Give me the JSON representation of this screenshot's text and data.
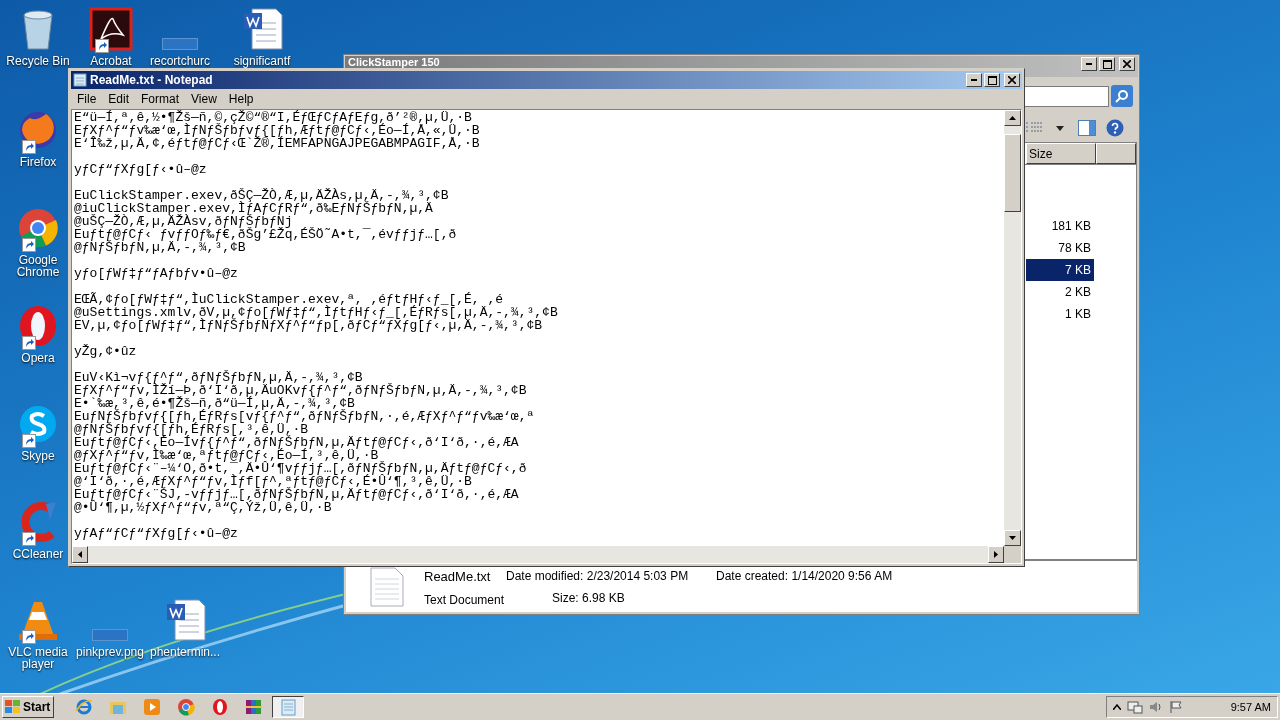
{
  "desktop_icons": [
    {
      "label": "Recycle Bin",
      "kind": "recycle",
      "shortcut": false
    },
    {
      "label": "Acrobat",
      "kind": "acrobat",
      "shortcut": true
    },
    {
      "label": "recortchurc",
      "kind": "image",
      "shortcut": false
    },
    {
      "label": "significantf",
      "kind": "word",
      "shortcut": false
    },
    {
      "label": "Firefox",
      "kind": "firefox",
      "shortcut": true
    },
    {
      "label": "Google Chrome",
      "kind": "chrome",
      "shortcut": true
    },
    {
      "label": "Opera",
      "kind": "opera",
      "shortcut": true
    },
    {
      "label": "Skype",
      "kind": "skype",
      "shortcut": true
    },
    {
      "label": "CCleaner",
      "kind": "ccleaner",
      "shortcut": true
    },
    {
      "label": "VLC media player",
      "kind": "vlc",
      "shortcut": true
    },
    {
      "label": "pinkprev.png",
      "kind": "image",
      "shortcut": false
    },
    {
      "label": "phentermin...",
      "kind": "word",
      "shortcut": false
    }
  ],
  "explorer": {
    "title": "ClickStamper 150",
    "column": "Size",
    "rows": [
      {
        "size": "181 KB",
        "selected": false
      },
      {
        "size": "78 KB",
        "selected": false
      },
      {
        "size": "7 KB",
        "selected": true
      },
      {
        "size": "2 KB",
        "selected": false
      },
      {
        "size": "1 KB",
        "selected": false
      }
    ],
    "details": {
      "name": "ReadMe.txt",
      "type": "Text Document",
      "modified_label": "Date modified:",
      "modified": "2/23/2014 5:03 PM",
      "created_label": "Date created:",
      "created": "1/14/2020 9:56 AM",
      "size_label": "Size:",
      "size": "6.98 KB"
    }
  },
  "notepad": {
    "title": "ReadMe.txt - Notepad",
    "menu": [
      "File",
      "Edit",
      "Format",
      "View",
      "Help"
    ],
    "paragraphs": [
      [
        "E“ü—Í,ª,ê,½•¶Žš—ñ,©,çŽ©“®“I,ÉƒŒƒCƒAƒEƒg,ð’²®,µ,Ü,·B",
        "EƒXƒ^ƒ“ƒv‰æ‘œ,ÌƒNƒŠƒbƒvƒ{[ƒh,Æƒtƒ@ƒCƒ‹,Éo—Í,Å,«,Ü,·B",
        "E‘Î‰ž,µ,Ä,¢,éƒtƒ@ƒCƒ‹Œ`Ž®,ÍEMFAPNGAJPEGABMPAGIF,Å,·B"
      ],
      [
        "yƒCƒ“ƒXƒg[ƒ‹•û–@z"
      ],
      [
        "EuClickStamper.exev,ðŠÇ—ŽÒ,Æ,µ,ÄŽÀs,µ,Ä,-,¾,³,¢B",
        "@iuClickStamper.exev,ÌƒAƒCƒRƒ“,ð‰EƒNƒŠƒbƒN,µ,Ä",
        "@uŠÇ—ŽÒ,Æ,µ,ÄŽÀsv,ðƒNƒŠƒbƒNj",
        "Euƒtƒ@ƒCƒ‹ ƒvƒƒOƒ‰ƒ€,ðŠg’£Žq,ÉŠÖ˜A•t,¯,évƒƒjƒ…[,ð",
        "@ƒNƒŠƒbƒN,µ,Ä,-,¾,³,¢B"
      ],
      [
        "yƒo[ƒWƒ‡ƒ“ƒAƒbƒv•û–@z"
      ],
      [
        "EŒÃ,¢ƒo[ƒWƒ‡ƒ“,ÌuClickStamper.exev,ª, ,éƒtƒHƒ‹ƒ_[,É, ,é",
        "@uSettings.xmlv,ðV,µ,¢ƒo[ƒWƒ‡ƒ“,ÌƒtƒHƒ‹ƒ_[,ÉƒRƒs[,µ,Ä,-,¾,³,¢B",
        "EV,µ,¢ƒo[ƒWƒ‡ƒ“,ÌƒNƒŠƒbƒNƒXƒ^ƒ“ƒp[,ðƒCƒ“ƒXƒg[ƒ‹,µ,Ä,-,¾,³,¢B"
      ],
      [
        "yŽg,¢•ûz"
      ],
      [
        "EuV‹Kì¬vƒ{ƒ^ƒ“,ðƒNƒŠƒbƒN,µ,Ä,-,¾,³,¢B",
        "EƒXƒ^ƒ“ƒv,ÌŽí—Þ,ð‘I‘ð,µ,ÄuOKvƒ{ƒ^ƒ“,ðƒNƒŠƒbƒN,µ,Ä,-,¾,³,¢B",
        "E•`‰æ,³,ê,é•¶Žš—ñ,ð“ü—Í,µ,Ä,-,¾,³,¢B",
        "EuƒNƒŠƒbƒvƒ{[ƒh,ÉƒRƒs[vƒ{ƒ^ƒ“,ðƒNƒŠƒbƒN,·,é,ÆƒXƒ^ƒ“ƒv‰æ‘œ,ª",
        "@ƒNƒŠƒbƒvƒ{[ƒh,ÉƒRƒs[,³,ê,Ü,·B",
        "Euƒtƒ@ƒCƒ‹,Éo—Ívƒ{ƒ^ƒ“,ðƒNƒŠƒbƒN,µ,Äƒtƒ@ƒCƒ‹,ð‘I‘ð,·,é,ÆA",
        "@ƒXƒ^ƒ“ƒv,Ì‰æ‘œ,ªƒtƒ@ƒCƒ‹,Éo—Í,³,ê,Ü,·B",
        "Euƒtƒ@ƒCƒ‹¨–¼‘O,ð•t,¯,Ä•Û‘¶vƒƒjƒ…[,ðƒNƒŠƒbƒN,µ,Äƒtƒ@ƒCƒ‹,ð",
        "@‘I‘ð,·,é,ÆƒXƒ^ƒ“ƒv,Ìƒf[ƒ^,ªƒtƒ@ƒCƒ‹,É•Û‘¶,³,ê,Ü,·B",
        "Euƒtƒ@ƒCƒ‹¨ŠJ,-vƒƒjƒ…[,ðƒNƒŠƒbƒN,µ,Äƒtƒ@ƒCƒ‹,ð‘I‘ð,·,é,ÆA",
        "@•Û‘¶,µ,½ƒXƒ^ƒ“ƒv,ª“Ç,Ýž,Ü,ê,Ü,·B"
      ],
      [
        "yƒAƒ“ƒCƒ“ƒXƒg[ƒ‹•û–@z"
      ]
    ]
  },
  "taskbar": {
    "start": "Start",
    "apps": [
      {
        "kind": "ie",
        "active": false
      },
      {
        "kind": "folder",
        "active": false
      },
      {
        "kind": "media",
        "active": false
      },
      {
        "kind": "chrome",
        "active": false
      },
      {
        "kind": "opera",
        "active": false
      },
      {
        "kind": "winrar",
        "active": false
      },
      {
        "kind": "notepad",
        "active": true
      }
    ],
    "clock": "9:57 AM"
  }
}
